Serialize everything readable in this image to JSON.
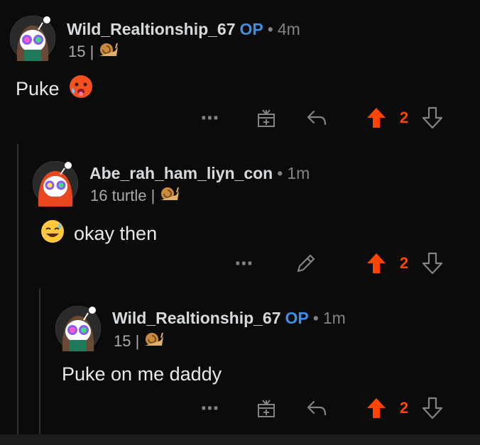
{
  "comments": [
    {
      "username": "Wild_Realtionship_67",
      "op_badge": "OP",
      "separator": "•",
      "time": "4m",
      "flair": "15 |",
      "body": "Puke",
      "score": "2",
      "body_emoji_icon": "hot-face-emoji-icon"
    },
    {
      "username": "Abe_rah_ham_liyn_con",
      "separator": "•",
      "time": "1m",
      "flair": "16 turtle |",
      "body": "okay then",
      "score": "2",
      "body_emoji_icon": "sweat-smile-emoji-icon"
    },
    {
      "username": "Wild_Realtionship_67",
      "op_badge": "OP",
      "separator": "•",
      "time": "1m",
      "flair": "15 |",
      "body": "Puke on me daddy",
      "score": "2"
    }
  ],
  "icons": {
    "more": "more-options-icon",
    "award": "award-gift-icon",
    "reply": "reply-icon",
    "edit": "edit-pencil-icon",
    "upvote": "upvote-arrow-icon",
    "downvote": "downvote-arrow-icon",
    "snail": "snail-flair-icon"
  },
  "colors": {
    "background": "#0b0b0b",
    "upvoted": "#ff4500",
    "op": "#3f8fe6",
    "muted": "#818384"
  }
}
